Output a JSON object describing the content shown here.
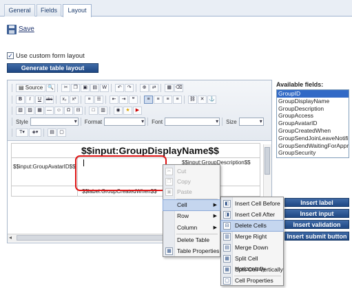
{
  "tabs": [
    {
      "label": "General"
    },
    {
      "label": "Fields"
    },
    {
      "label": "Layout"
    }
  ],
  "save": {
    "label": "Save"
  },
  "custom_layout": {
    "label": "Use custom form layout",
    "checked": "✓"
  },
  "generate_button": {
    "label": "Generate table layout"
  },
  "toolbar": {
    "source_label": "Source",
    "style_label": "Style",
    "format_label": "Format",
    "font_label": "Font",
    "size_label": "Size",
    "bold": "B",
    "italic": "I",
    "underline": "U",
    "strike": "abc",
    "sub": "x₂",
    "sup": "x²"
  },
  "content": {
    "display_name": "$$input:GroupDisplayName$$",
    "avatar": "$$input:GroupAvatarID$$",
    "description": "$$input:GroupDescription$$",
    "created": "$$label:GroupCreatedWhen$$"
  },
  "available_fields": {
    "title": "Available fields:",
    "items": [
      "GroupID",
      "GroupDisplayName",
      "GroupDescription",
      "GroupAccess",
      "GroupAvatarID",
      "GroupCreatedWhen",
      "GroupSendJoinLeaveNotifi",
      "GroupSendWaitingForAppr",
      "GroupSecurity"
    ]
  },
  "side_buttons": {
    "insert_label": "Insert label",
    "insert_input": "Insert input",
    "insert_validation": "Insert validation label",
    "insert_submit": "Insert submit button"
  },
  "context_menu": {
    "items": [
      {
        "label": "Cut",
        "disabled": true
      },
      {
        "label": "Copy",
        "disabled": true
      },
      {
        "label": "Paste",
        "disabled": true
      },
      {
        "label": "Cell"
      },
      {
        "label": "Row"
      },
      {
        "label": "Column"
      },
      {
        "label": "Delete Table"
      },
      {
        "label": "Table Properties"
      }
    ]
  },
  "submenu": {
    "items": [
      {
        "label": "Insert Cell Before"
      },
      {
        "label": "Insert Cell After"
      },
      {
        "label": "Delete Cells"
      },
      {
        "label": "Merge Right"
      },
      {
        "label": "Merge Down"
      },
      {
        "label": "Split Cell Horizontally"
      },
      {
        "label": "Split Cell Vertically"
      },
      {
        "label": "Cell Properties"
      }
    ]
  },
  "colors": {
    "accent": "#1e4783",
    "highlight": "#dd1111",
    "selection": "#3169c6"
  }
}
